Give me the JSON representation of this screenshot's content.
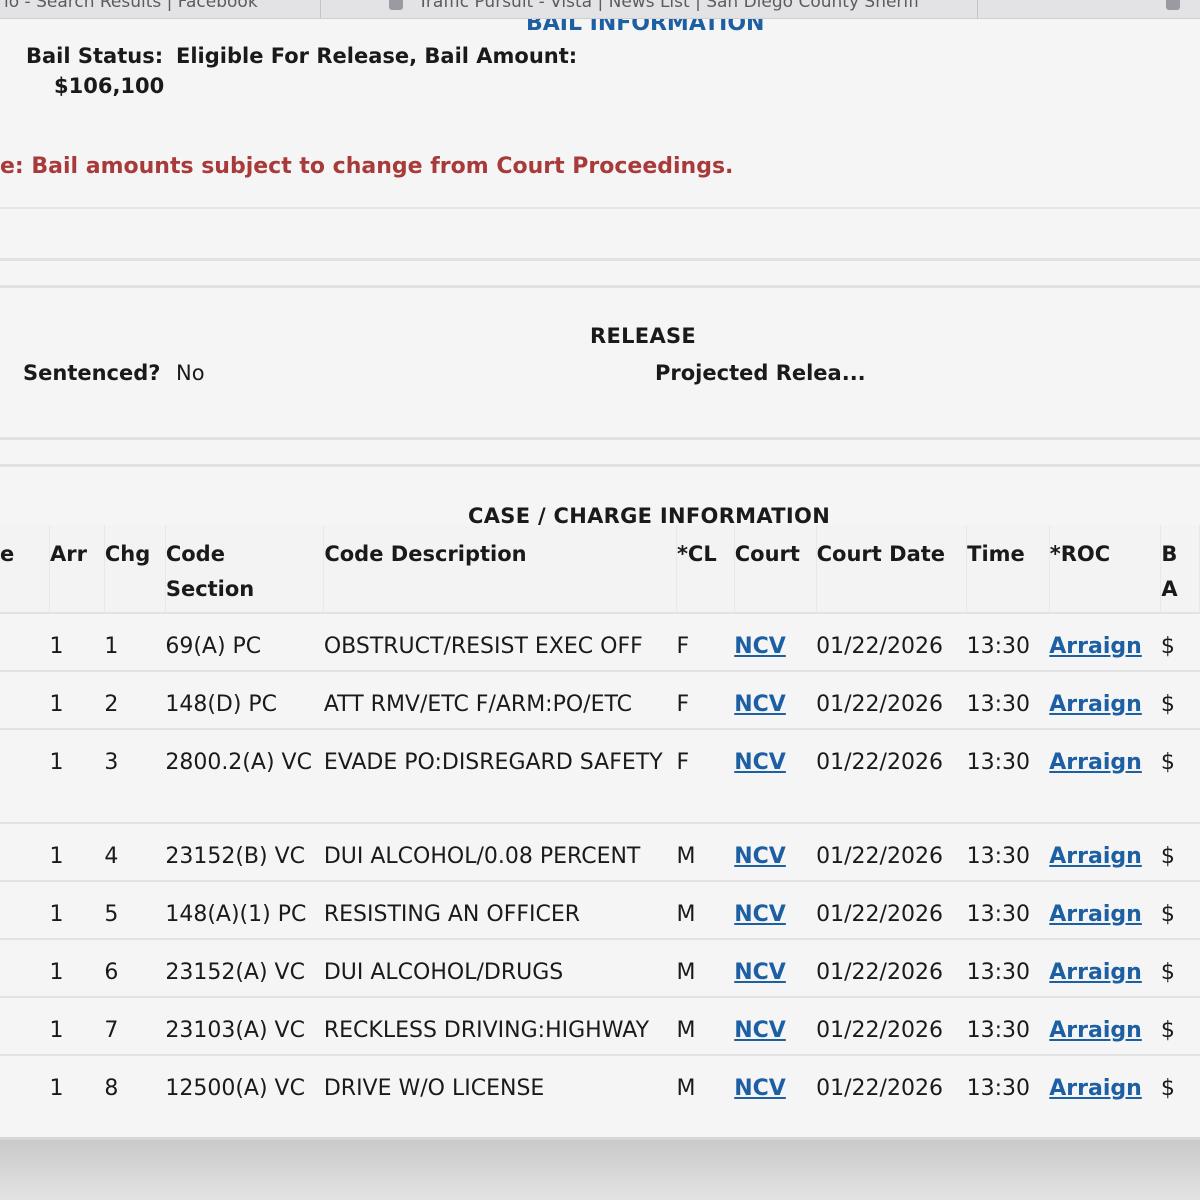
{
  "browser": {
    "tabs": [
      {
        "label": "lo - Search Results | Facebook"
      },
      {
        "label": "Traffic Pursuit - Vista | News List | San Diego County Sheriff"
      }
    ]
  },
  "bail": {
    "section_title": "BAIL INFORMATION",
    "status_label": "Bail Status:",
    "status_value": "Eligible For Release, Bail Amount:",
    "amount": "$106,100",
    "note": "e: Bail amounts subject to change from Court Proceedings."
  },
  "release": {
    "section_title": "RELEASE",
    "sentenced_label": "Sentenced?",
    "sentenced_value": "No",
    "projected_label": "Projected Relea..."
  },
  "charges": {
    "section_title": "CASE / CHARGE INFORMATION",
    "columns": {
      "case": "e",
      "arr": "Arr",
      "chg": "Chg",
      "code_section_1": "Code",
      "code_section_2": "Section",
      "code_description": "Code Description",
      "cl": "*CL",
      "court": "Court",
      "court_date": "Court Date",
      "time": "Time",
      "roc": "*ROC",
      "bail_1": "B",
      "bail_2": "A"
    },
    "rows": [
      {
        "arr": "1",
        "chg": "1",
        "code": "69(A) PC",
        "desc": "OBSTRUCT/RESIST EXEC OFF",
        "cl": "F",
        "court": "NCV",
        "date": "01/22/2026",
        "time": "13:30",
        "roc": "Arraign",
        "bail": "$"
      },
      {
        "arr": "1",
        "chg": "2",
        "code": "148(D) PC",
        "desc": "ATT RMV/ETC F/ARM:PO/ETC",
        "cl": "F",
        "court": "NCV",
        "date": "01/22/2026",
        "time": "13:30",
        "roc": "Arraign",
        "bail": "$"
      },
      {
        "arr": "1",
        "chg": "3",
        "code": "2800.2(A) VC",
        "desc": "EVADE PO:DISREGARD SAFETY",
        "cl": "F",
        "court": "NCV",
        "date": "01/22/2026",
        "time": "13:30",
        "roc": "Arraign",
        "bail": "$"
      },
      {
        "arr": "1",
        "chg": "4",
        "code": "23152(B) VC",
        "desc": "DUI ALCOHOL/0.08 PERCENT",
        "cl": "M",
        "court": "NCV",
        "date": "01/22/2026",
        "time": "13:30",
        "roc": "Arraign",
        "bail": "$"
      },
      {
        "arr": "1",
        "chg": "5",
        "code": "148(A)(1) PC",
        "desc": "RESISTING AN OFFICER",
        "cl": "M",
        "court": "NCV",
        "date": "01/22/2026",
        "time": "13:30",
        "roc": "Arraign",
        "bail": "$"
      },
      {
        "arr": "1",
        "chg": "6",
        "code": "23152(A) VC",
        "desc": "DUI ALCOHOL/DRUGS",
        "cl": "M",
        "court": "NCV",
        "date": "01/22/2026",
        "time": "13:30",
        "roc": "Arraign",
        "bail": "$"
      },
      {
        "arr": "1",
        "chg": "7",
        "code": "23103(A) VC",
        "desc": "RECKLESS DRIVING:HIGHWAY",
        "cl": "M",
        "court": "NCV",
        "date": "01/22/2026",
        "time": "13:30",
        "roc": "Arraign",
        "bail": "$"
      },
      {
        "arr": "1",
        "chg": "8",
        "code": "12500(A) VC",
        "desc": "DRIVE W/O LICENSE",
        "cl": "M",
        "court": "NCV",
        "date": "01/22/2026",
        "time": "13:30",
        "roc": "Arraign",
        "bail": "$"
      }
    ]
  }
}
